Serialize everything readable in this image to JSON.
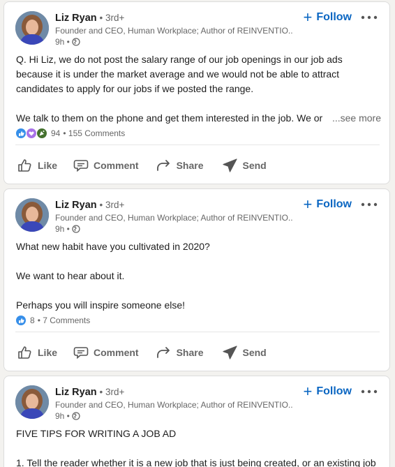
{
  "colors": {
    "accent": "#0a66c2",
    "muted": "#666666",
    "like": "#378fe9",
    "support": "#a872e8",
    "celebrate": "#44712e"
  },
  "posts": [
    {
      "author": "Liz Ryan",
      "degree": "• 3rd+",
      "headline": "Founder and CEO, Human Workplace; Author of REINVENTIO...",
      "time": "9h •",
      "follow": "Follow",
      "body": [
        "Q. Hi Liz, we do not post the salary range of our job openings in our job ads",
        "because it is under the market average and we would not be able to attract",
        "candidates to apply for our jobs if we posted the range.",
        "",
        "We talk to them on the phone and get them interested in the job. We or"
      ],
      "see_more": "...see more",
      "reactions": [
        "like-icon",
        "support-icon",
        "celebrate-icon"
      ],
      "reaction_count": "94",
      "comments": "• 155 Comments"
    },
    {
      "author": "Liz Ryan",
      "degree": "• 3rd+",
      "headline": "Founder and CEO, Human Workplace; Author of REINVENTIO...",
      "time": "9h •",
      "follow": "Follow",
      "body": [
        "What new habit have you cultivated in 2020?",
        "",
        "We want to hear about it.",
        "",
        "Perhaps you will inspire someone else!"
      ],
      "reactions": [
        "like-icon"
      ],
      "reaction_count": "8",
      "comments": "• 7 Comments"
    },
    {
      "author": "Liz Ryan",
      "degree": "• 3rd+",
      "headline": "Founder and CEO, Human Workplace; Author of REINVENTIO...",
      "time": "9h •",
      "follow": "Follow",
      "body": [
        "FIVE TIPS FOR WRITING A JOB AD",
        "",
        "1. Tell the reader whether it is a new job that is just being created, or an existing job"
      ]
    }
  ],
  "actions": {
    "like": "Like",
    "comment": "Comment",
    "share": "Share",
    "send": "Send"
  }
}
